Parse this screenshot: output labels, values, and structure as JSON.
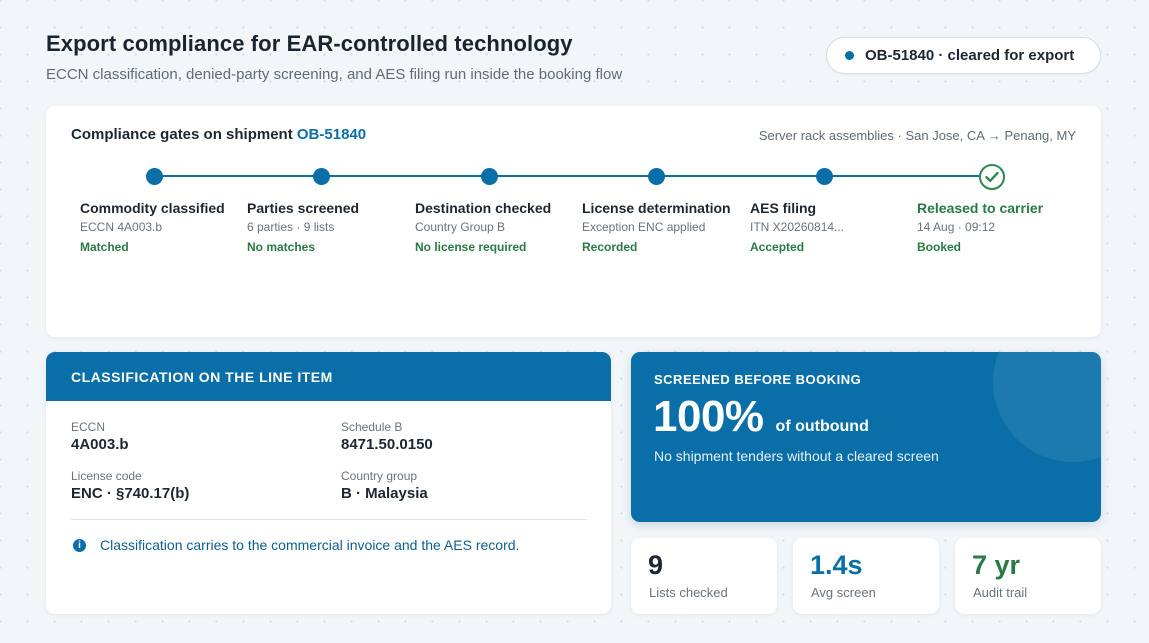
{
  "header": {
    "title": "Export compliance for EAR-controlled technology",
    "subtitle": "ECCN classification, denied-party screening, and AES filing run inside the booking flow",
    "status": "OB-51840 · cleared for export"
  },
  "gates": {
    "title_prefix": "Compliance gates on shipment",
    "shipment_id": "OB-51840",
    "route": "Server rack assemblies · San Jose, CA → Penang, MY",
    "steps": [
      {
        "label": "Commodity classified",
        "detail": "ECCN 4A003.b",
        "status": "Matched"
      },
      {
        "label": "Parties screened",
        "detail": "6 parties · 9 lists",
        "status": "No matches"
      },
      {
        "label": "Destination checked",
        "detail": "Country Group B",
        "status": "No license required"
      },
      {
        "label": "License determination",
        "detail": "Exception ENC applied",
        "status": "Recorded"
      },
      {
        "label": "AES filing",
        "detail": "ITN X20260814...",
        "status": "Accepted"
      },
      {
        "label": "Released to carrier",
        "detail": "14 Aug · 09:12",
        "status": "Booked"
      }
    ]
  },
  "classification": {
    "header": "CLASSIFICATION ON THE LINE ITEM",
    "fields": [
      {
        "label": "ECCN",
        "value": "4A003.b"
      },
      {
        "label": "Schedule B",
        "value": "8471.50.0150"
      },
      {
        "label": "License code",
        "value": "ENC · §740.17(b)"
      },
      {
        "label": "Country group",
        "value": "B · Malaysia"
      }
    ],
    "info_icon": "info-icon",
    "note": "Classification carries to the commercial invoice and the AES record."
  },
  "screening": {
    "eyebrow": "SCREENED BEFORE BOOKING",
    "percent": "100%",
    "unit": "of outbound",
    "note": "No shipment tenders without a cleared screen"
  },
  "stats": [
    {
      "value": "9",
      "label": "Lists checked",
      "color": "#1d2733"
    },
    {
      "value": "1.4s",
      "label": "Avg screen",
      "color": "#0a6fa8"
    },
    {
      "value": "7 yr",
      "label": "Audit trail",
      "color": "#2a7a45"
    }
  ],
  "colors": {
    "accent": "#0a6fa8",
    "success": "#2a7a45"
  }
}
